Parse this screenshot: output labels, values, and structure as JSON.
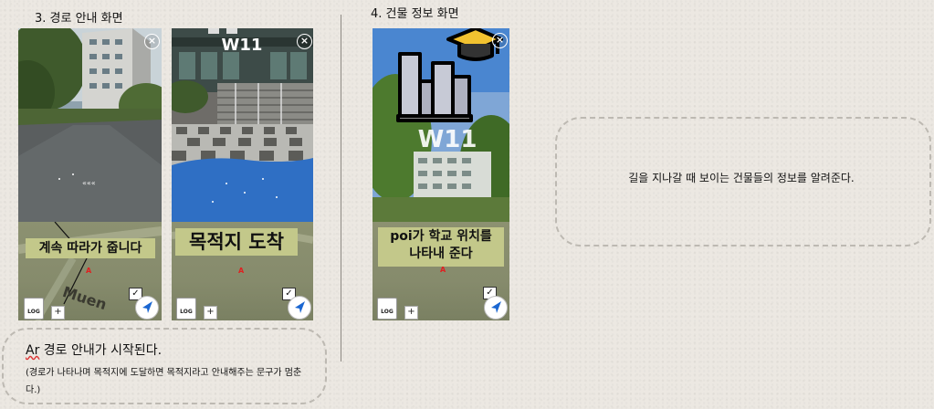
{
  "sections": {
    "route_title": "3. 경로 안내 화면",
    "building_title": "4. 건물 정보 화면"
  },
  "phones": {
    "phone1": {
      "banner": "계속 따라가 줍니다",
      "map_label": "Muen",
      "log": "LOG",
      "plus": "+",
      "pin": "A",
      "close": "×",
      "check": "✓"
    },
    "phone2": {
      "banner": "목적지 도착",
      "building_sign": "W11",
      "log": "LOG",
      "plus": "+",
      "pin": "A",
      "close": "×",
      "check": "✓"
    },
    "phone3": {
      "banner_line1": "poi가 학교 위치를",
      "banner_line2": "나타내 준다",
      "building_sign": "W11",
      "log": "LOG",
      "plus": "+",
      "pin": "A",
      "close": "×",
      "check": "✓"
    }
  },
  "captions": {
    "route_main_prefix": "Ar",
    "route_main_rest": " 경로 안내가 시작된다.",
    "route_sub": "(경로가 나타나며 목적지에 도달하면 목적지라고 안내해주는 문구가 멈춘다.)",
    "building": "길을 지나갈 때 보이는 건물들의 정보를 알려준다."
  },
  "icons": {
    "poi": "school-building-icon",
    "nav": "navigation-arrow-icon",
    "log": "log-file-icon"
  },
  "colors": {
    "banner_bg": "#c3c88a",
    "map_bg": "#868b6c",
    "pin": "#e02020",
    "water": "#2f6fc4"
  }
}
